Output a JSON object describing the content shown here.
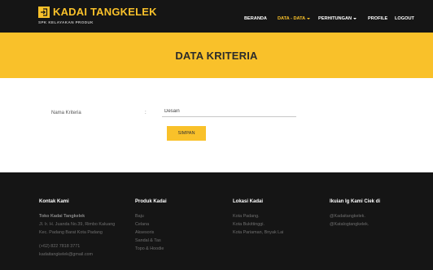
{
  "brand": {
    "name": "KADAI TANGKELEK",
    "tagline": "SPK KELAYAKAN PRODUK",
    "icon": "sign-in-icon"
  },
  "nav": {
    "items": [
      {
        "label": "BERANDA",
        "active": false,
        "dropdown": false
      },
      {
        "label": "DATA - DATA",
        "active": true,
        "dropdown": true
      },
      {
        "label": "PERHITUNGAN",
        "active": false,
        "dropdown": true
      },
      {
        "label": "PROFILE",
        "active": false,
        "dropdown": false
      },
      {
        "label": "LOGOUT",
        "active": false,
        "dropdown": false
      }
    ]
  },
  "hero": {
    "title": "DATA KRITERIA"
  },
  "form": {
    "label": "Nama Kriteria",
    "colon": ":",
    "value": "Desain",
    "button": "SIMPAN"
  },
  "footer": {
    "kontak": {
      "heading": "Kontak Kami",
      "name": "Toko Kadai Tangkelek",
      "address_line1": "Jl. Ir. H. Juanda No.39, Rimbo Kaluang",
      "address_line2": "Kec. Padang Barat Kota Padang",
      "phone": "(+62) 822 7818 3771",
      "email": "kadaitangkelek@gmail.com"
    },
    "produk": {
      "heading": "Produk Kadai",
      "items": [
        "Baju",
        "Celana",
        "Aksesoris",
        "Sandal & Tas",
        "Topo & Hoodie"
      ]
    },
    "lokasi": {
      "heading": "Lokasi Kadai",
      "items": [
        "Kota Padang.",
        "Kota Bukittinggi.",
        "Kota Pariaman, Bnyak Lai"
      ]
    },
    "ig": {
      "heading": "Ikuian Ig Kami Ciek di",
      "items": [
        "@Kadaitangkelek.",
        "@Katalogtangkelek."
      ]
    }
  },
  "colors": {
    "accent": "#f9c12a",
    "dark": "#151515"
  }
}
